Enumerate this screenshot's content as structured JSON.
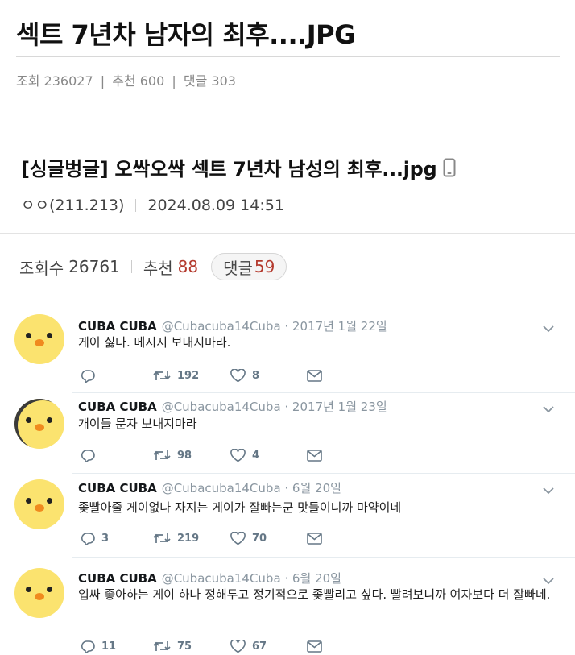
{
  "post": {
    "title": "섹트 7년차 남자의 최후....JPG",
    "stats": {
      "views_label": "조회",
      "views": "236027",
      "recommend_label": "추천",
      "recommend": "600",
      "comments_label": "댓글",
      "comments": "303",
      "separator": "|"
    }
  },
  "capture": {
    "title": "[싱글벙글] 오싹오싹 섹트 7년차 남성의 최후...jpg",
    "author": "ㅇㅇ(211.213)",
    "datetime": "2024.08.09 14:51",
    "views_label": "조회수",
    "views": "26761",
    "recommend_label": "추천",
    "recommend": "88",
    "comments_label": "댓글",
    "comments": "59"
  },
  "tweets": [
    {
      "name": "CUBA CUBA",
      "handle": "@Cubacuba14Cuba · 2017년 1월 22일",
      "text": "게이 싫다. 메시지 보내지마라.",
      "replies": "",
      "retweets": "192",
      "likes": "8"
    },
    {
      "name": "CUBA CUBA",
      "handle": "@Cubacuba14Cuba · 2017년 1월 23일",
      "text": "개이들 문자 보내지마라",
      "replies": "",
      "retweets": "98",
      "likes": "4"
    },
    {
      "name": "CUBA CUBA",
      "handle": "@Cubacuba14Cuba · 6월 20일",
      "text": "좆빨아줄 게이없나 자지는 게이가 잘빠는군 맛들이니까 마약이네",
      "replies": "3",
      "retweets": "219",
      "likes": "70"
    },
    {
      "name": "CUBA CUBA",
      "handle": "@Cubacuba14Cuba · 6월 20일",
      "text": "입싸 좋아하는 게이 하나 정해두고 정기적으로 좆빨리고 싶다. 빨려보니까 여자보다 더 잘빠네.",
      "replies": "11",
      "retweets": "75",
      "likes": "67"
    }
  ],
  "icons": {
    "reply": "reply-icon",
    "retweet": "retweet-icon",
    "like": "heart-icon",
    "message": "envelope-icon",
    "caret": "chevron-down-icon",
    "device": "mobile-phone-icon"
  },
  "colors": {
    "accent_red": "#b43a2e",
    "avatar_yellow": "#fbe36f",
    "beak_orange": "#f08a1e",
    "meta_gray": "#888888",
    "tweet_gray": "#657786"
  }
}
